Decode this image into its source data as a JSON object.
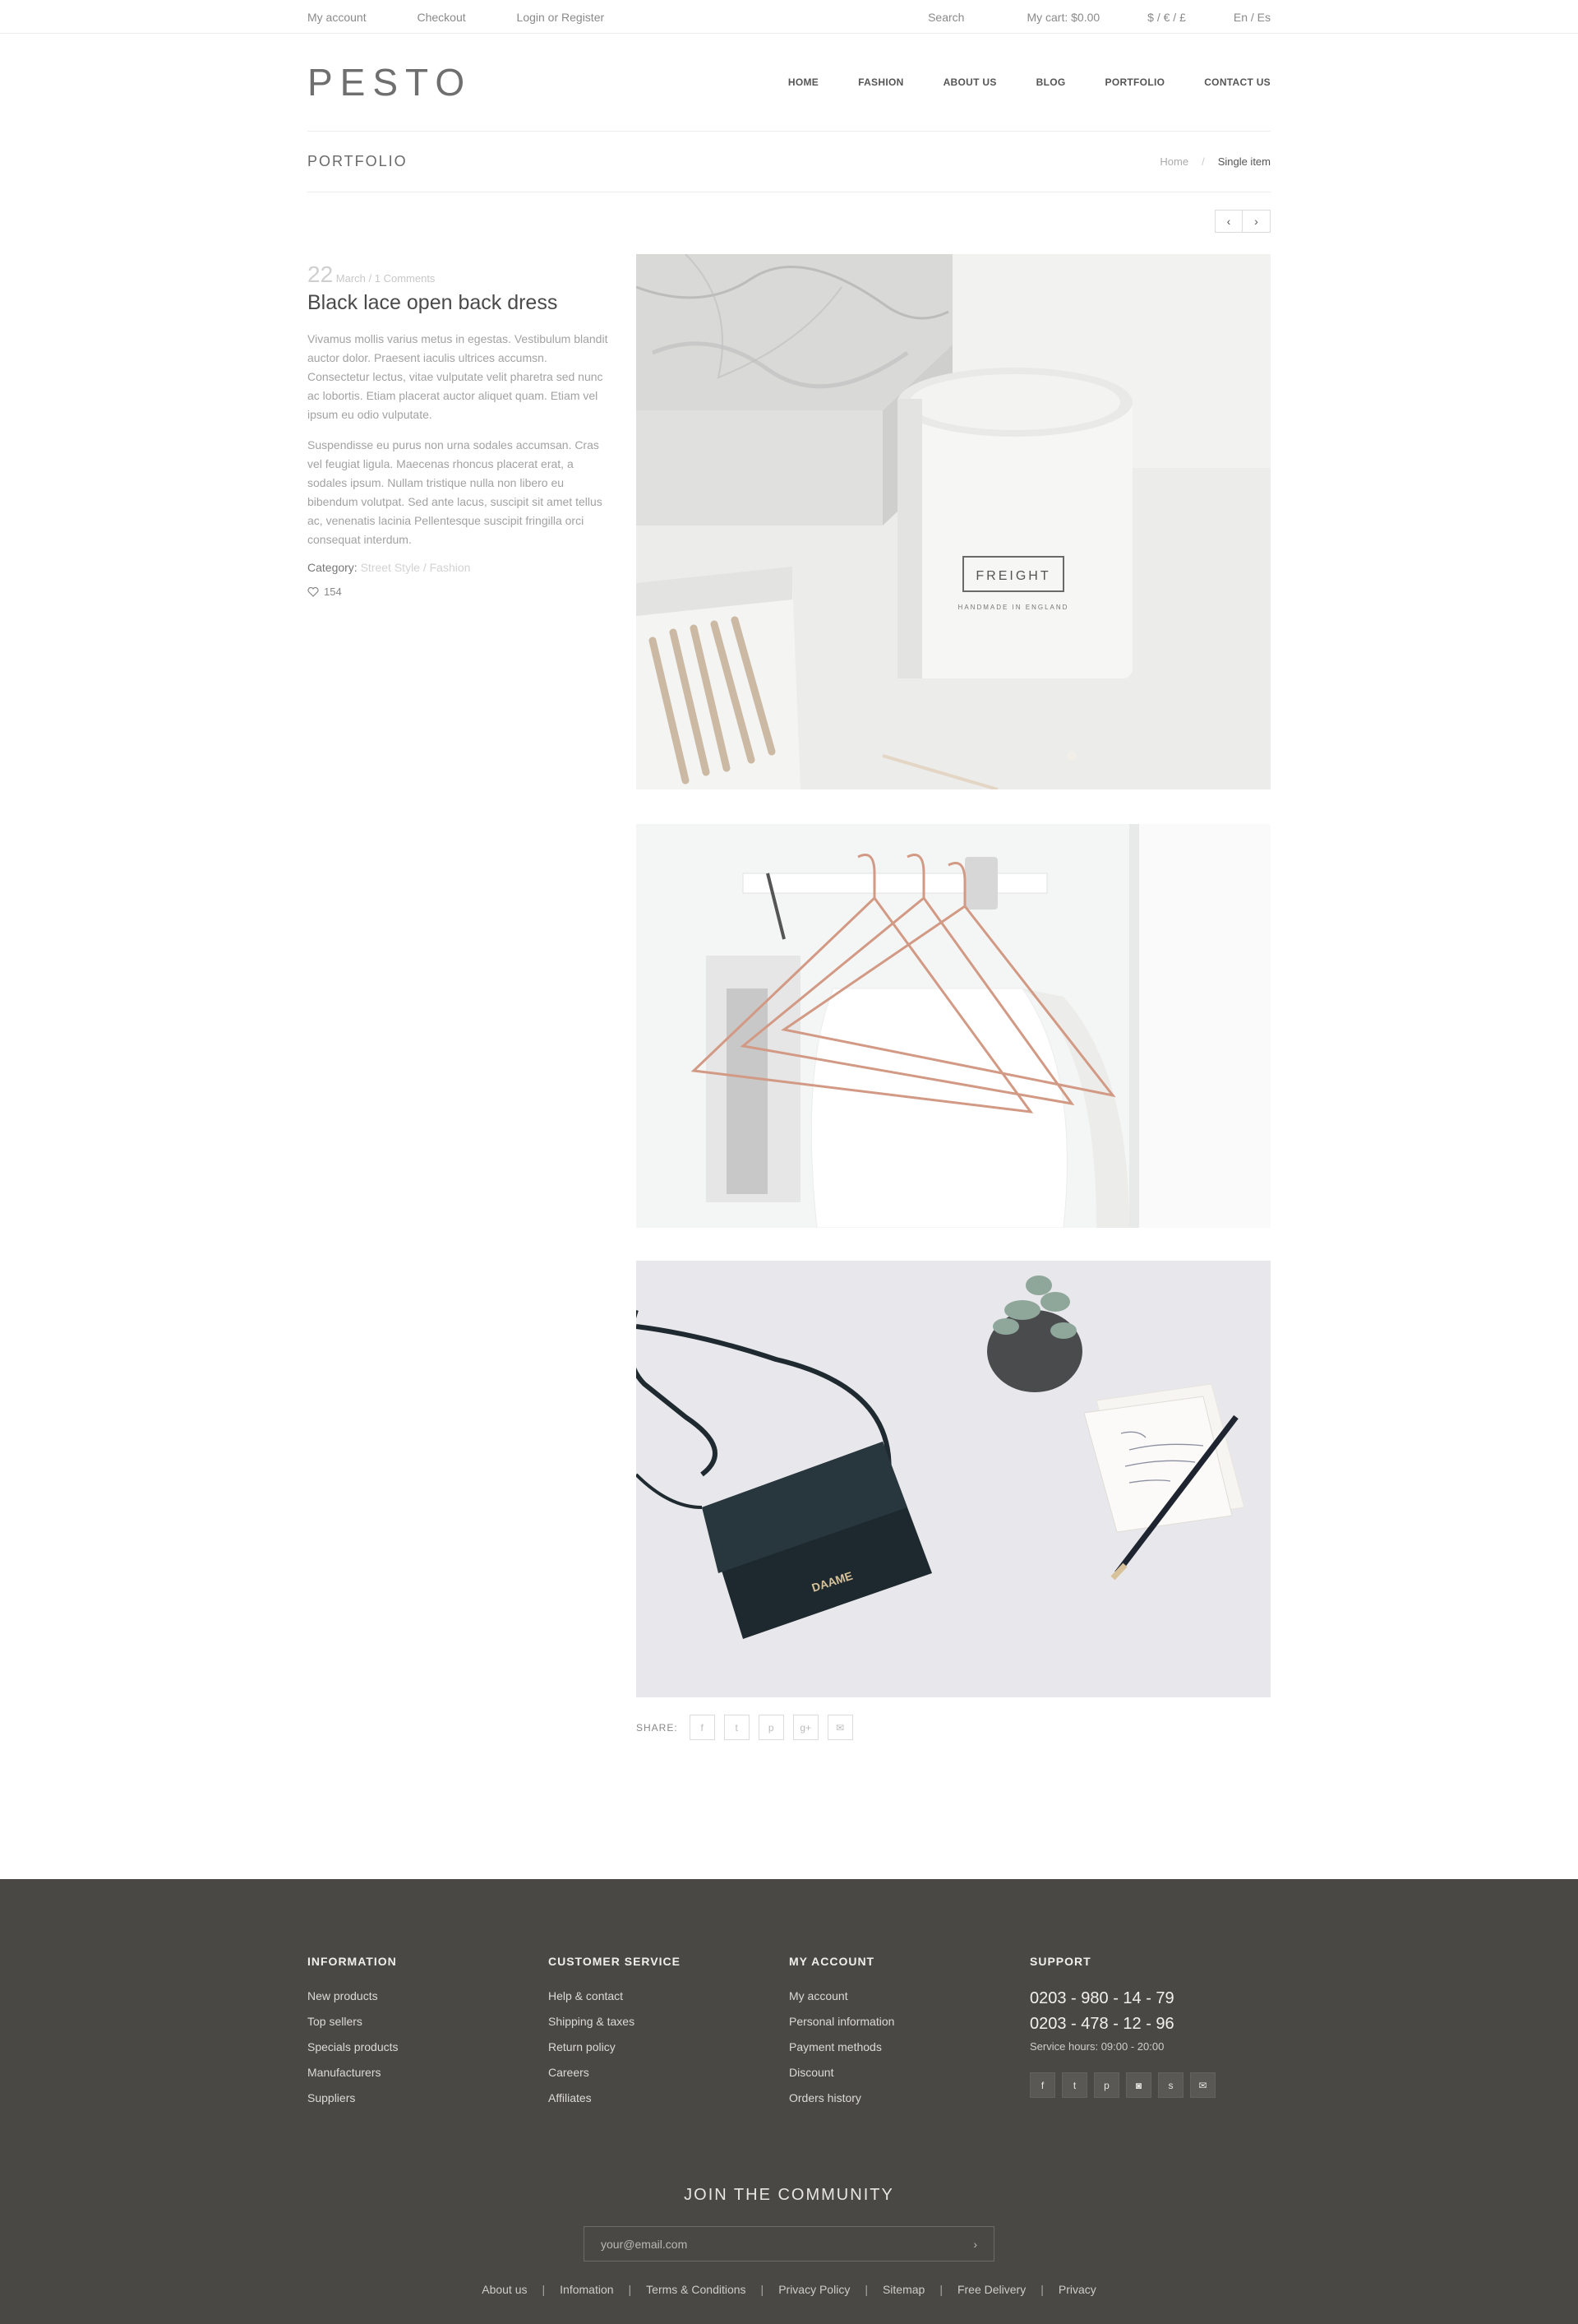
{
  "topbar": {
    "my_account": "My account",
    "checkout": "Checkout",
    "login": "Login or Register",
    "search": "Search",
    "cart": "My cart: $0.00",
    "currency": "$ / € / £",
    "language": "En / Es"
  },
  "header": {
    "logo": "PESTO",
    "nav": [
      "HOME",
      "FASHION",
      "ABOUT US",
      "BLOG",
      "PORTFOLIO",
      "CONTACT US"
    ]
  },
  "page_title": {
    "title": "PORTFOLIO",
    "breadcrumb_home": "Home",
    "breadcrumb_sep": "/",
    "breadcrumb_current": "Single item"
  },
  "pager": {
    "prev": "‹",
    "next": "›"
  },
  "post": {
    "day": "22",
    "meta": "March / 1 Comments",
    "title": "Black lace open back dress",
    "para1": "Vivamus mollis varius metus in egestas. Vestibulum blandit auctor dolor. Praesent iaculis ultrices accumsn. Consectetur lectus, vitae vulputate velit pharetra sed nunc ac lobortis. Etiam placerat auctor aliquet quam. Etiam vel ipsum eu odio vulputate.",
    "para2": "Suspendisse eu purus non urna sodales accumsan. Cras vel feugiat ligula. Maecenas rhoncus placerat erat, a sodales ipsum. Nullam tristique nulla non libero eu bibendum volutpat. Sed ante lacus, suscipit sit amet tellus ac, venenatis lacinia Pellentesque suscipit fringilla orci consequat interdum.",
    "category_label": "Category:",
    "category_values": "Street Style / Fashion",
    "likes": "154"
  },
  "images": {
    "candle_label": "FREIGHT",
    "candle_sub": "HANDMADE IN ENGLAND",
    "bag_label": "DAAME"
  },
  "share": {
    "label": "SHARE:",
    "icons": [
      "f",
      "t",
      "p",
      "g+",
      "✉"
    ]
  },
  "footer": {
    "information": {
      "title": "INFORMATION",
      "links": [
        "New products",
        "Top sellers",
        "Specials products",
        "Manufacturers",
        "Suppliers"
      ]
    },
    "customer_service": {
      "title": "CUSTOMER SERVICE",
      "links": [
        "Help & contact",
        "Shipping & taxes",
        "Return policy",
        "Careers",
        "Affiliates"
      ]
    },
    "my_account": {
      "title": "MY ACCOUNT",
      "links": [
        "My account",
        "Personal information",
        "Payment methods",
        "Discount",
        "Orders history"
      ]
    },
    "support": {
      "title": "SUPPORT",
      "phone1": "0203 - 980 - 14 - 79",
      "phone2": "0203 - 478 - 12 - 96",
      "hours": "Service hours: 09:00 - 20:00",
      "socials": [
        "f",
        "t",
        "p",
        "◙",
        "s",
        "✉"
      ]
    },
    "join": "JOIN THE COMMUNITY",
    "email_placeholder": "your@email.com",
    "email_go": "›",
    "bottom_links": [
      "About us",
      "Infomation",
      "Terms & Conditions",
      "Privacy Policy",
      "Sitemap",
      "Free Delivery",
      "Privacy"
    ],
    "bottom_sep": "|"
  }
}
